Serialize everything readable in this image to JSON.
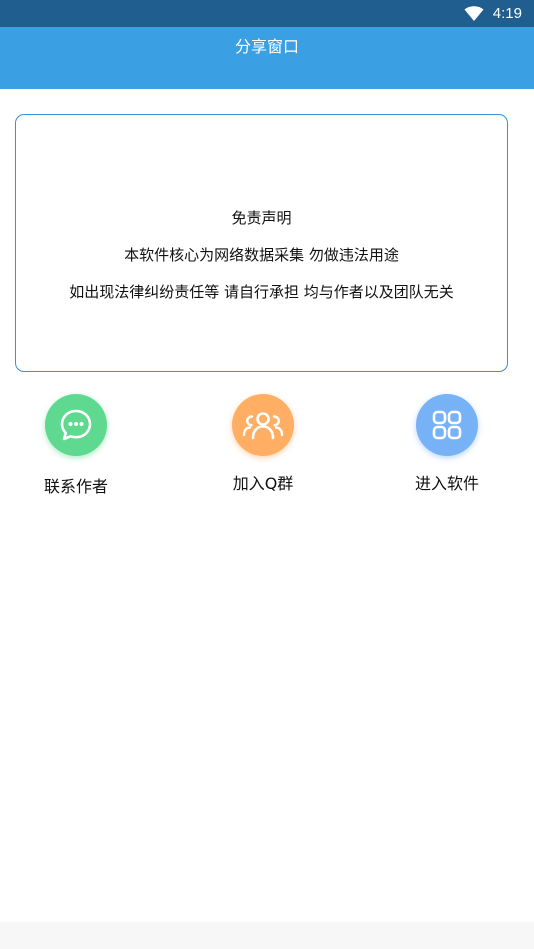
{
  "status_bar": {
    "time": "4:19"
  },
  "app_bar": {
    "title": "分享窗口"
  },
  "disclaimer": {
    "heading": "免责声明",
    "line1": "本软件核心为网络数据采集 勿做违法用途",
    "line2": "如出现法律纠纷责任等 请自行承担 均与作者以及团队无关"
  },
  "actions": [
    {
      "label": "联系作者",
      "icon": "chat-bubble-icon",
      "color": "#5ed98f"
    },
    {
      "label": "加入Q群",
      "icon": "group-icon",
      "color": "#ffae63"
    },
    {
      "label": "进入软件",
      "icon": "apps-grid-icon",
      "color": "#76b2f5"
    }
  ],
  "colors": {
    "status_bar": "#1f5e8f",
    "app_bar": "#3a9fe3",
    "card_border": "#3a8fd6"
  }
}
